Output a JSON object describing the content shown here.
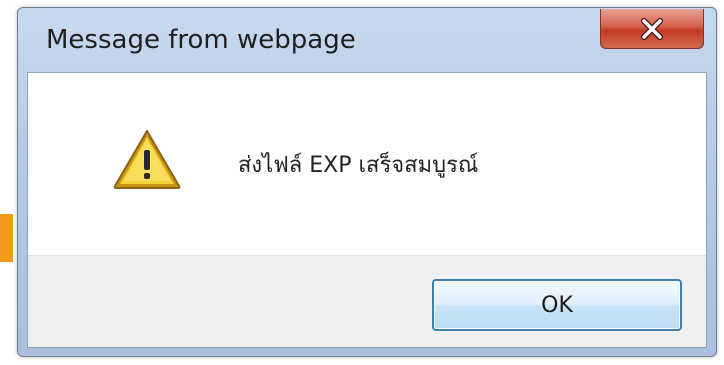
{
  "dialog": {
    "title": "Message from webpage",
    "close_icon": "close-icon",
    "message_icon": "warning-icon",
    "message": "ส่งไฟล์ EXP เสร็จสมบูรณ์",
    "ok_label": "OK"
  },
  "colors": {
    "accent_bar": "#f39a1e",
    "close_button": "#c94a34",
    "ok_border": "#3c7fb1",
    "warning_yellow": "#f2c81c"
  }
}
